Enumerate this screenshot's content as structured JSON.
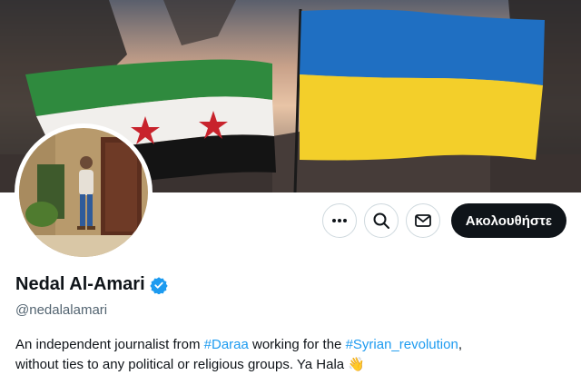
{
  "profile": {
    "name": "Nedal Al-Amari",
    "handle": "@nedalalamari",
    "verified": true,
    "bio": {
      "part1": "An independent journalist from ",
      "hashtag1": "#Daraa",
      "part2": " working for the ",
      "hashtag2": "#Syrian_revolution",
      "part3": ",",
      "part4": "without ties to any political or religious groups. Ya Hala ",
      "emoji": "👋"
    }
  },
  "actions": {
    "more_icon": "more-horizontal-icon",
    "search_icon": "search-icon",
    "message_icon": "envelope-icon",
    "follow_label": "Ακολουθήστε"
  },
  "colors": {
    "accent": "#1d9bf0",
    "follow_bg": "#0f1419",
    "text_secondary": "#536471"
  }
}
